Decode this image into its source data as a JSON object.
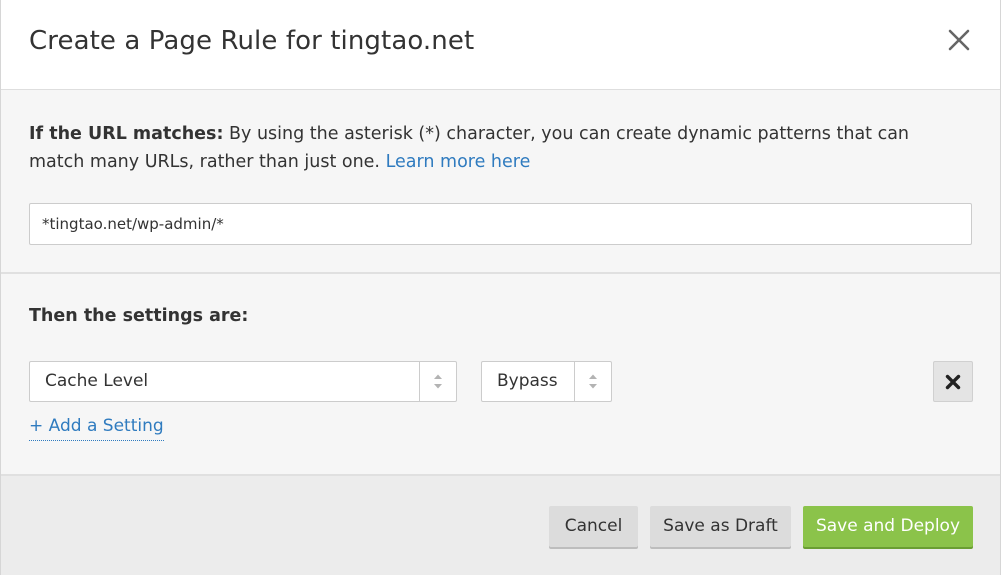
{
  "dialog": {
    "title": "Create a Page Rule for tingtao.net"
  },
  "url_section": {
    "label": "If the URL matches:",
    "description": " By using the asterisk (*) character, you can create dynamic patterns that can match many URLs, rather than just one. ",
    "learn_more": "Learn more here",
    "url_value": "*tingtao.net/wp-admin/*"
  },
  "settings_section": {
    "title": "Then the settings are:",
    "setting_name": "Cache Level",
    "setting_value": "Bypass",
    "add_setting": "+ Add a Setting"
  },
  "footer": {
    "cancel": "Cancel",
    "save_draft": "Save as Draft",
    "save_deploy": "Save and Deploy"
  },
  "colors": {
    "link": "#2f7bbf",
    "primary": "#8bc34a"
  },
  "icons": {
    "close": "close-icon",
    "remove": "remove-setting-icon",
    "select_arrows": "select-arrows-icon"
  }
}
